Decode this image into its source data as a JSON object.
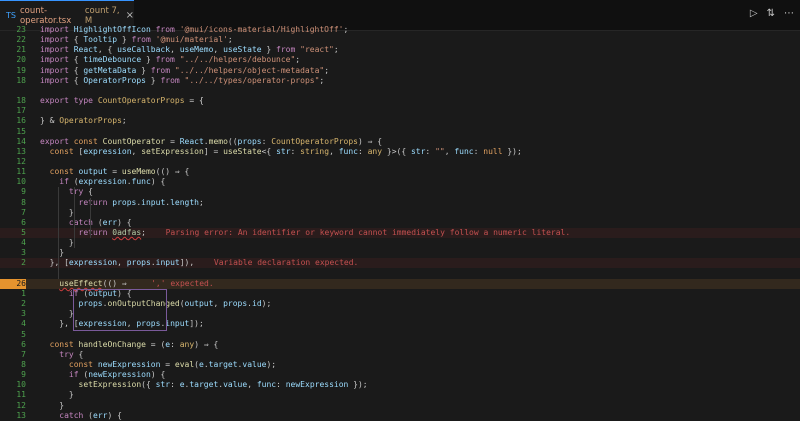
{
  "tab": {
    "filename": "count-operator.tsx",
    "meta": "count 7, M",
    "close": "×",
    "icon": "TS"
  },
  "actions": [
    "run-icon",
    "split-icon",
    "more-icon"
  ],
  "actions_glyphs": [
    "▷",
    "⇅",
    "⋯"
  ],
  "lines": [
    {
      "n": "23",
      "c": [
        [
          "kw",
          "import "
        ],
        [
          "var",
          "HighlightOffIcon"
        ],
        [
          "kw",
          " from "
        ],
        [
          "str",
          "'@mui/icons-material/HighlightOff'"
        ],
        [
          "pun",
          ";"
        ]
      ]
    },
    {
      "n": "22",
      "c": [
        [
          "kw",
          "import "
        ],
        [
          "pun",
          "{ "
        ],
        [
          "var",
          "Tooltip"
        ],
        [
          "pun",
          " } "
        ],
        [
          "kw",
          "from "
        ],
        [
          "str",
          "'@mui/material'"
        ],
        [
          "pun",
          ";"
        ]
      ]
    },
    {
      "n": "21",
      "c": [
        [
          "kw",
          "import "
        ],
        [
          "var",
          "React"
        ],
        [
          "pun",
          ", { "
        ],
        [
          "var",
          "useCallback"
        ],
        [
          "pun",
          ", "
        ],
        [
          "var",
          "useMemo"
        ],
        [
          "pun",
          ", "
        ],
        [
          "var",
          "useState"
        ],
        [
          "pun",
          " } "
        ],
        [
          "kw",
          "from "
        ],
        [
          "str",
          "\"react\""
        ],
        [
          "pun",
          ";"
        ]
      ]
    },
    {
      "n": "20",
      "c": [
        [
          "kw",
          "import "
        ],
        [
          "pun",
          "{ "
        ],
        [
          "var",
          "timeDebounce"
        ],
        [
          "pun",
          " } "
        ],
        [
          "kw",
          "from "
        ],
        [
          "str",
          "\"../../helpers/debounce\""
        ],
        [
          "pun",
          ";"
        ]
      ]
    },
    {
      "n": "19",
      "c": [
        [
          "kw",
          "import "
        ],
        [
          "pun",
          "{ "
        ],
        [
          "var",
          "getMetaData"
        ],
        [
          "pun",
          " } "
        ],
        [
          "kw",
          "from "
        ],
        [
          "str",
          "\"../../helpers/object-metadata\""
        ],
        [
          "pun",
          ";"
        ]
      ]
    },
    {
      "n": "18",
      "c": [
        [
          "kw",
          "import "
        ],
        [
          "pun",
          "{ "
        ],
        [
          "var",
          "OperatorProps"
        ],
        [
          "pun",
          " } "
        ],
        [
          "kw",
          "from "
        ],
        [
          "str",
          "\"../../types/operator-props\""
        ],
        [
          "pun",
          ";"
        ]
      ]
    },
    {
      "n": "",
      "c": []
    },
    {
      "n": "18",
      "c": [
        [
          "kw",
          "export "
        ],
        [
          "kw",
          "type "
        ],
        [
          "type",
          "CountOperatorProps"
        ],
        [
          "op",
          " = {"
        ]
      ]
    },
    {
      "n": "17",
      "c": []
    },
    {
      "n": "16",
      "c": [
        [
          "pun",
          "} & "
        ],
        [
          "type",
          "OperatorProps"
        ],
        [
          "pun",
          ";"
        ]
      ]
    },
    {
      "n": "15",
      "c": []
    },
    {
      "n": "14",
      "c": [
        [
          "kw",
          "export "
        ],
        [
          "kw2",
          "const "
        ],
        [
          "fn",
          "CountOperator"
        ],
        [
          "op",
          " = "
        ],
        [
          "var",
          "React"
        ],
        [
          "pun",
          "."
        ],
        [
          "fn",
          "memo"
        ],
        [
          "pun",
          "(("
        ],
        [
          "var",
          "props"
        ],
        [
          "pun",
          ": "
        ],
        [
          "type",
          "CountOperatorProps"
        ],
        [
          "pun",
          ") ⇒ {"
        ]
      ]
    },
    {
      "n": "13",
      "c": [
        [
          "pun",
          "  "
        ],
        [
          "kw2",
          "const "
        ],
        [
          "pun",
          "["
        ],
        [
          "var",
          "expression"
        ],
        [
          "pun",
          ", "
        ],
        [
          "fn",
          "setExpression"
        ],
        [
          "pun",
          "] = "
        ],
        [
          "fn",
          "useState"
        ],
        [
          "pun",
          "<{ "
        ],
        [
          "var",
          "str"
        ],
        [
          "pun",
          ": "
        ],
        [
          "type",
          "string"
        ],
        [
          "pun",
          ", "
        ],
        [
          "var",
          "func"
        ],
        [
          "pun",
          ": "
        ],
        [
          "type",
          "any"
        ],
        [
          "pun",
          " }>({ "
        ],
        [
          "var",
          "str"
        ],
        [
          "pun",
          ": "
        ],
        [
          "str",
          "\"\""
        ],
        [
          "pun",
          ", "
        ],
        [
          "var",
          "func"
        ],
        [
          "pun",
          ": "
        ],
        [
          "kw2",
          "null"
        ],
        [
          "pun",
          " });"
        ]
      ]
    },
    {
      "n": "12",
      "c": []
    },
    {
      "n": "11",
      "c": [
        [
          "pun",
          "  "
        ],
        [
          "kw2",
          "const "
        ],
        [
          "var",
          "output"
        ],
        [
          "op",
          " = "
        ],
        [
          "fn",
          "useMemo"
        ],
        [
          "pun",
          "(() ⇒ {"
        ]
      ]
    },
    {
      "n": "10",
      "c": [
        [
          "pun",
          "    "
        ],
        [
          "kw",
          "if "
        ],
        [
          "pun",
          "("
        ],
        [
          "var",
          "expression"
        ],
        [
          "pun",
          "."
        ],
        [
          "var",
          "func"
        ],
        [
          "pun",
          ") {"
        ]
      ]
    },
    {
      "n": "9",
      "c": [
        [
          "pun",
          "      "
        ],
        [
          "kw",
          "try "
        ],
        [
          "pun",
          "{"
        ]
      ]
    },
    {
      "n": "8",
      "c": [
        [
          "pun",
          "        "
        ],
        [
          "kw",
          "return "
        ],
        [
          "var",
          "props"
        ],
        [
          "pun",
          "."
        ],
        [
          "var",
          "input"
        ],
        [
          "pun",
          "."
        ],
        [
          "var",
          "length"
        ],
        [
          "pun",
          ";"
        ]
      ]
    },
    {
      "n": "7",
      "c": [
        [
          "pun",
          "      }"
        ]
      ]
    },
    {
      "n": "6",
      "c": [
        [
          "pun",
          "      "
        ],
        [
          "kw",
          "catch "
        ],
        [
          "pun",
          "("
        ],
        [
          "var",
          "err"
        ],
        [
          "pun",
          ") {"
        ]
      ]
    },
    {
      "n": "5",
      "err": true,
      "c": [
        [
          "pun",
          "        "
        ],
        [
          "kw",
          "return "
        ],
        [
          "num",
          "0adfas"
        ],
        [
          "pun",
          ";"
        ]
      ],
      "msg": "Parsing error: An identifier or keyword cannot immediately follow a numeric literal."
    },
    {
      "n": "4",
      "c": [
        [
          "pun",
          "      }"
        ]
      ]
    },
    {
      "n": "3",
      "c": [
        [
          "pun",
          "    }"
        ]
      ]
    },
    {
      "n": "2",
      "err": true,
      "c": [
        [
          "pun",
          "  }, ["
        ],
        [
          "var",
          "expression"
        ],
        [
          "pun",
          ", "
        ],
        [
          "var",
          "props"
        ],
        [
          "pun",
          "."
        ],
        [
          "var",
          "input"
        ],
        [
          "pun",
          "]),"
        ]
      ],
      "msg": "Variable declaration expected."
    },
    {
      "n": "",
      "c": []
    },
    {
      "n": "26",
      "cur": true,
      "c": [
        [
          "pun",
          "    "
        ],
        [
          "fn",
          "useEffect"
        ],
        [
          "pun",
          "(() ⇒ "
        ]
      ],
      "msg": "',' expected."
    },
    {
      "n": "1",
      "c": [
        [
          "pun",
          "      "
        ],
        [
          "kw",
          "if "
        ],
        [
          "pun",
          "("
        ],
        [
          "var",
          "output"
        ],
        [
          "pun",
          ") {"
        ]
      ]
    },
    {
      "n": "2",
      "c": [
        [
          "pun",
          "        "
        ],
        [
          "var",
          "props"
        ],
        [
          "pun",
          "."
        ],
        [
          "fn",
          "onOutputChanged"
        ],
        [
          "pun",
          "("
        ],
        [
          "var",
          "output"
        ],
        [
          "pun",
          ", "
        ],
        [
          "var",
          "props"
        ],
        [
          "pun",
          "."
        ],
        [
          "var",
          "id"
        ],
        [
          "pun",
          ");"
        ]
      ]
    },
    {
      "n": "3",
      "c": [
        [
          "pun",
          "      }"
        ]
      ]
    },
    {
      "n": "4",
      "c": [
        [
          "pun",
          "    }, ["
        ],
        [
          "var",
          "expression"
        ],
        [
          "pun",
          ", "
        ],
        [
          "var",
          "props"
        ],
        [
          "pun",
          "."
        ],
        [
          "var",
          "input"
        ],
        [
          "pun",
          "]);"
        ]
      ]
    },
    {
      "n": "5",
      "c": []
    },
    {
      "n": "6",
      "c": [
        [
          "pun",
          "  "
        ],
        [
          "kw2",
          "const "
        ],
        [
          "fn",
          "handleOnChange"
        ],
        [
          "op",
          " = "
        ],
        [
          "pun",
          "("
        ],
        [
          "var",
          "e"
        ],
        [
          "pun",
          ": "
        ],
        [
          "type",
          "any"
        ],
        [
          "pun",
          ") ⇒ {"
        ]
      ]
    },
    {
      "n": "7",
      "c": [
        [
          "pun",
          "    "
        ],
        [
          "kw",
          "try "
        ],
        [
          "pun",
          "{"
        ]
      ]
    },
    {
      "n": "8",
      "c": [
        [
          "pun",
          "      "
        ],
        [
          "kw2",
          "const "
        ],
        [
          "var",
          "newExpression"
        ],
        [
          "op",
          " = "
        ],
        [
          "fn",
          "eval"
        ],
        [
          "pun",
          "("
        ],
        [
          "var",
          "e"
        ],
        [
          "pun",
          "."
        ],
        [
          "var",
          "target"
        ],
        [
          "pun",
          "."
        ],
        [
          "var",
          "value"
        ],
        [
          "pun",
          ");"
        ]
      ]
    },
    {
      "n": "9",
      "c": [
        [
          "pun",
          "      "
        ],
        [
          "kw",
          "if "
        ],
        [
          "pun",
          "("
        ],
        [
          "var",
          "newExpression"
        ],
        [
          "pun",
          ") {"
        ]
      ]
    },
    {
      "n": "10",
      "c": [
        [
          "pun",
          "        "
        ],
        [
          "fn",
          "setExpression"
        ],
        [
          "pun",
          "({ "
        ],
        [
          "var",
          "str"
        ],
        [
          "pun",
          ": "
        ],
        [
          "var",
          "e"
        ],
        [
          "pun",
          "."
        ],
        [
          "var",
          "target"
        ],
        [
          "pun",
          "."
        ],
        [
          "var",
          "value"
        ],
        [
          "pun",
          ", "
        ],
        [
          "var",
          "func"
        ],
        [
          "pun",
          ": "
        ],
        [
          "var",
          "newExpression"
        ],
        [
          "pun",
          " });"
        ]
      ]
    },
    {
      "n": "11",
      "c": [
        [
          "pun",
          "      }"
        ]
      ]
    },
    {
      "n": "12",
      "c": [
        [
          "pun",
          "    }"
        ]
      ]
    },
    {
      "n": "13",
      "c": [
        [
          "pun",
          "    "
        ],
        [
          "kw",
          "catch "
        ],
        [
          "pun",
          "("
        ],
        [
          "var",
          "err"
        ],
        [
          "pun",
          ") {"
        ]
      ]
    }
  ]
}
